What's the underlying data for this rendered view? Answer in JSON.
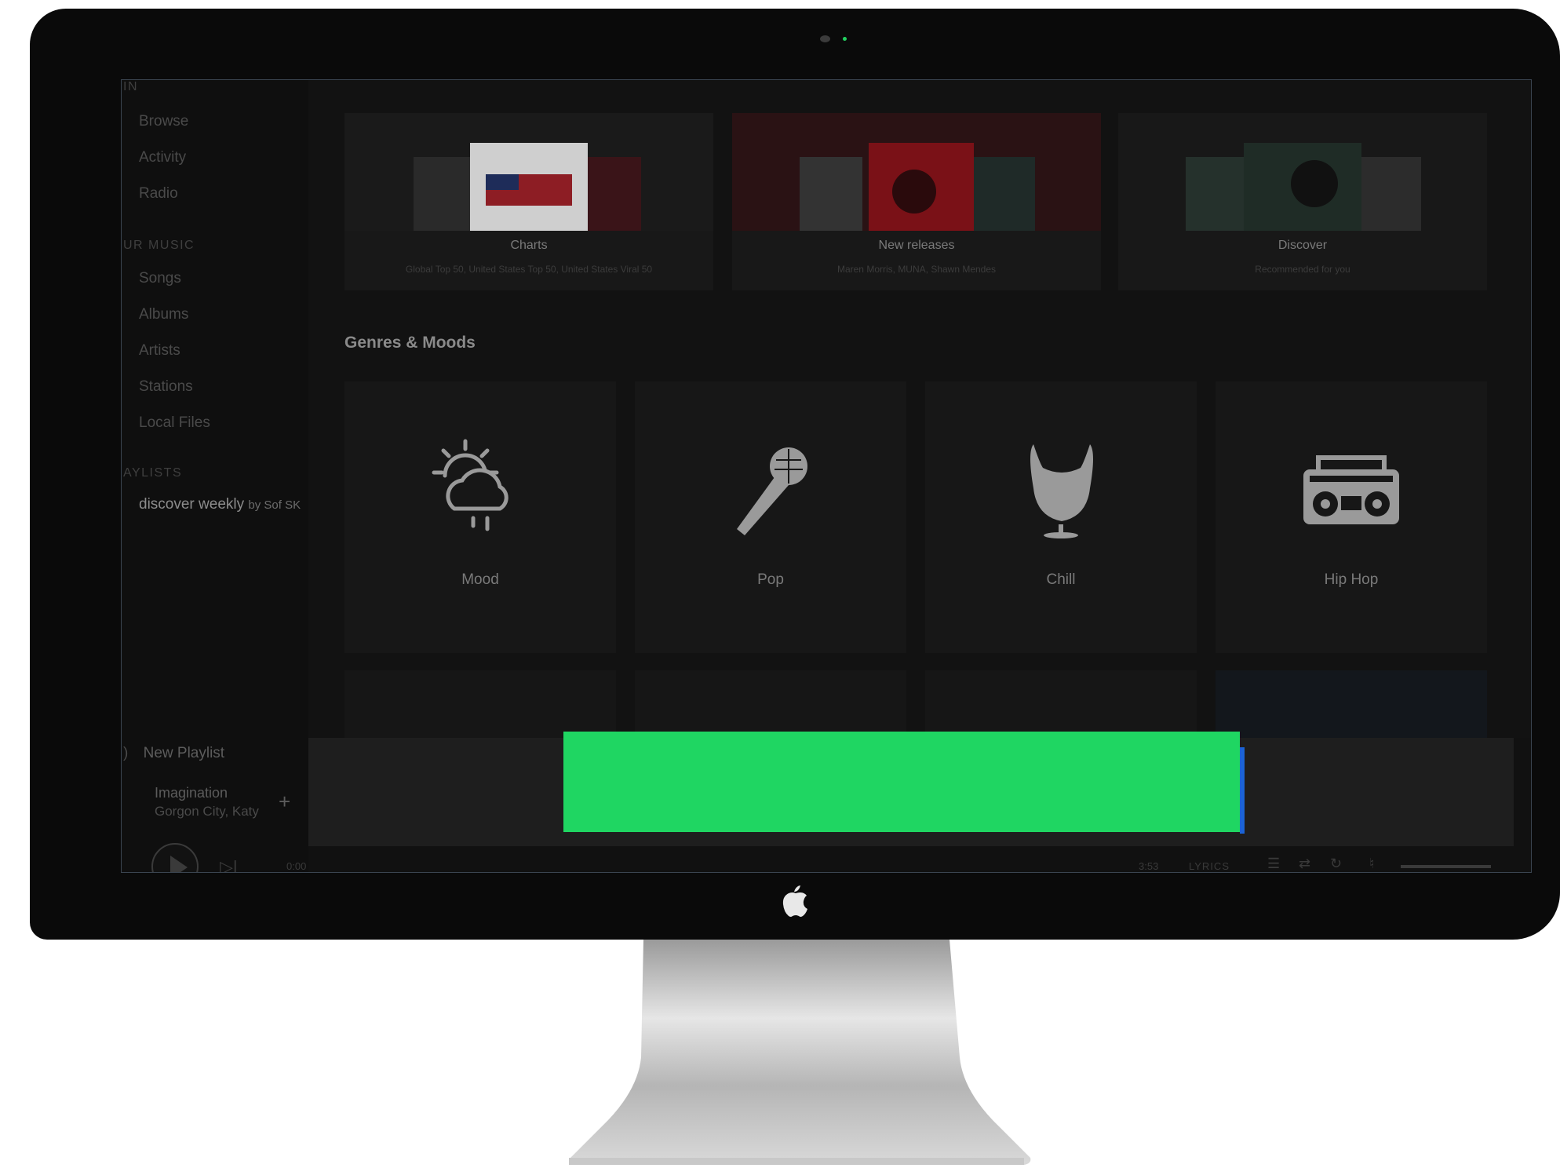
{
  "sidebar": {
    "section_main": "IN",
    "main_items": [
      "Browse",
      "Activity",
      "Radio"
    ],
    "section_music": "UR MUSIC",
    "music_items": [
      "Songs",
      "Albums",
      "Artists",
      "Stations",
      "Local Files"
    ],
    "section_playlists": "AYLISTS",
    "playlist_name": "discover weekly",
    "playlist_owner": "by Sof SK",
    "new_playlist": "New Playlist"
  },
  "now_playing": {
    "title": "Imagination",
    "artist": "Gorgon City, Katy",
    "add": "+"
  },
  "top_cards": [
    {
      "title": "Charts",
      "subtitle": "Global Top 50, United States Top 50, United States Viral 50"
    },
    {
      "title": "New releases",
      "subtitle": "Maren Morris, MUNA, Shawn Mendes"
    },
    {
      "title": "Discover",
      "subtitle": "Recommended for you"
    }
  ],
  "genres_heading": "Genres & Moods",
  "genres": [
    {
      "label": "Mood",
      "icon": "weather-icon"
    },
    {
      "label": "Pop",
      "icon": "microphone-icon"
    },
    {
      "label": "Chill",
      "icon": "egg-chair-icon"
    },
    {
      "label": "Hip Hop",
      "icon": "boombox-icon"
    }
  ],
  "player": {
    "time_elapsed": "0:00",
    "time_total": "3:53",
    "lyrics": "LYRICS"
  },
  "colors": {
    "accent_green": "#1fd662",
    "monitor_bezel": "#0a0a0a",
    "screen_bg": "#121212"
  }
}
